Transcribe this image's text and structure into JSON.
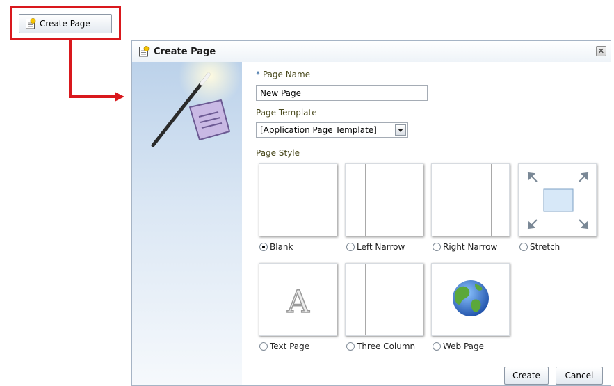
{
  "trigger": {
    "label": "Create Page"
  },
  "dialog": {
    "title": "Create Page",
    "close_symbol": "✕",
    "page_name": {
      "required_mark": "*",
      "label": "Page Name",
      "value": "New Page"
    },
    "page_template": {
      "label": "Page Template",
      "selected": "[Application Page Template]"
    },
    "page_style": {
      "label": "Page Style",
      "options": [
        {
          "label": "Blank",
          "checked": true
        },
        {
          "label": "Left Narrow",
          "checked": false
        },
        {
          "label": "Right Narrow",
          "checked": false
        },
        {
          "label": "Stretch",
          "checked": false
        },
        {
          "label": "Text Page",
          "checked": false
        },
        {
          "label": "Three Column",
          "checked": false
        },
        {
          "label": "Web Page",
          "checked": false
        }
      ]
    },
    "buttons": {
      "create": "Create",
      "cancel": "Cancel"
    }
  },
  "colors": {
    "callout": "#d9181d",
    "label": "#4a4a1e",
    "accent": "#3b6ea5"
  },
  "icons": [
    "new-page-icon",
    "close-icon",
    "magic-wand-icon",
    "document-icon",
    "expand-arrows-icon",
    "letter-a-icon",
    "globe-icon",
    "dropdown-arrow-icon"
  ]
}
